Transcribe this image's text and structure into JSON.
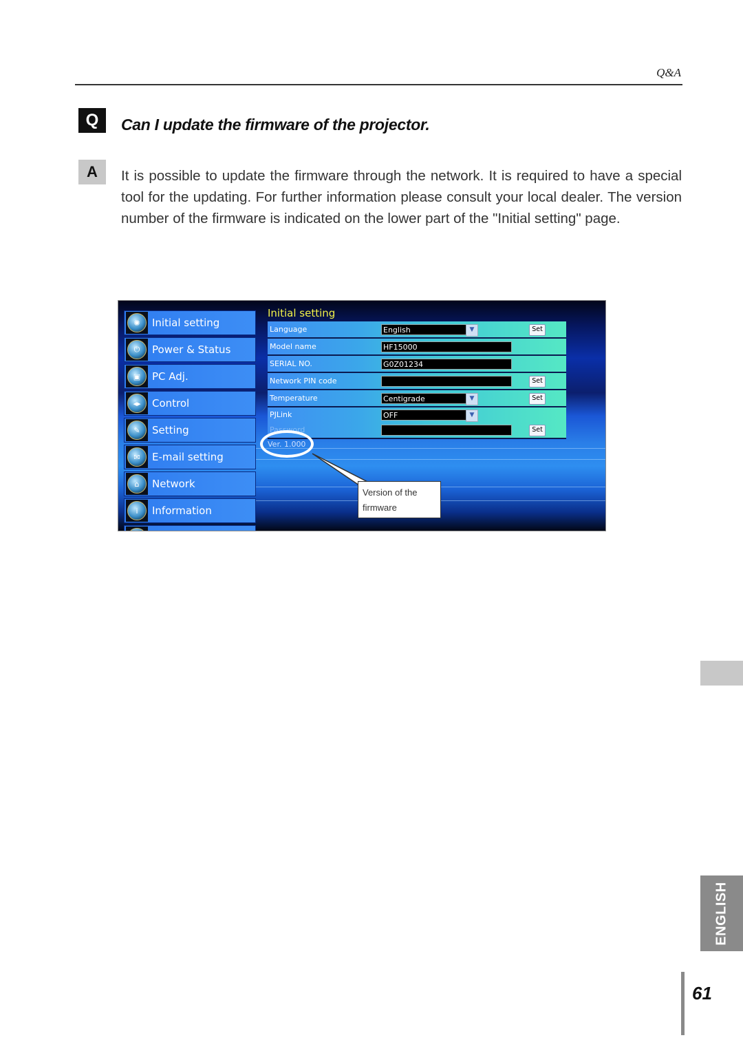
{
  "header": {
    "section_label": "Q&A"
  },
  "question": {
    "badge": "Q",
    "title": "Can I update the firmware of the projector."
  },
  "answer": {
    "badge": "A",
    "text": "It is possible to update the firmware through the network. It is required to have a special tool for the updating. For further information please consult your local dealer. The version number of the firmware is indicated on the lower part of the \"Initial setting\" page."
  },
  "screenshot": {
    "sidebar": {
      "items": [
        {
          "label": "Initial setting",
          "icon": "settings-icon"
        },
        {
          "label": "Power & Status",
          "icon": "power-icon"
        },
        {
          "label": "PC Adj.",
          "icon": "pc-icon"
        },
        {
          "label": "Control",
          "icon": "control-icon"
        },
        {
          "label": "Setting",
          "icon": "tools-icon"
        },
        {
          "label": "E-mail setting",
          "icon": "mail-icon"
        },
        {
          "label": "Network",
          "icon": "network-icon"
        },
        {
          "label": "Information",
          "icon": "info-icon"
        }
      ]
    },
    "panel": {
      "title": "Initial setting",
      "rows": {
        "language": {
          "label": "Language",
          "value": "English",
          "button": "Set"
        },
        "model": {
          "label": "Model name",
          "value": "HF15000"
        },
        "serial": {
          "label": "SERIAL NO.",
          "value": "G0Z01234"
        },
        "pin": {
          "label": "Network PIN code",
          "value": "",
          "button": "Set"
        },
        "temperature": {
          "label": "Temperature",
          "value": "Centigrade",
          "button": "Set"
        },
        "pjlink": {
          "label": "PJLink",
          "value": "OFF"
        },
        "password": {
          "label": "Password",
          "value": "",
          "button": "Set"
        }
      },
      "version": "Ver. 1.000"
    },
    "callout": {
      "line1": "Version of the",
      "line2": "firmware"
    }
  },
  "side_tab": {
    "language": "ENGLISH"
  },
  "footer": {
    "page_number": "61"
  }
}
